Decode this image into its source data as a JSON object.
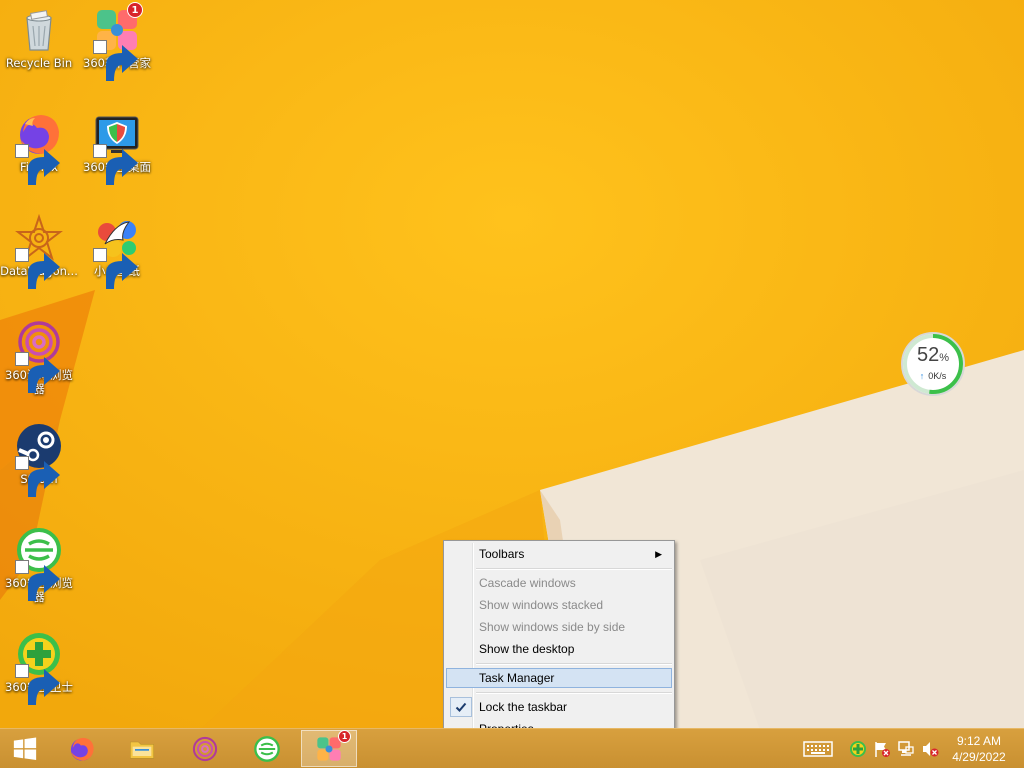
{
  "desktop": {
    "icons": [
      {
        "label": "Recycle Bin",
        "icon": "recycle-bin-icon",
        "shortcut": false
      },
      {
        "label": "360软件管家",
        "icon": "360-software-manager-icon",
        "shortcut": true,
        "badge": "1"
      },
      {
        "label": "Firefox",
        "icon": "firefox-icon",
        "shortcut": true
      },
      {
        "label": "360安全桌面",
        "icon": "360-safe-desktop-icon",
        "shortcut": true
      },
      {
        "label": "DataWagon...",
        "icon": "datawagon-icon",
        "shortcut": true
      },
      {
        "label": "小鸟壁纸",
        "icon": "bird-wallpaper-icon",
        "shortcut": true
      },
      {
        "label": "360游戏浏览器",
        "icon": "360-game-browser-icon",
        "shortcut": true
      },
      {
        "label": "Steam",
        "icon": "steam-icon",
        "shortcut": true
      },
      {
        "label": "360安全浏览器",
        "icon": "360-safe-browser-icon",
        "shortcut": true
      },
      {
        "label": "360安全卫士",
        "icon": "360-security-guard-icon",
        "shortcut": true
      }
    ]
  },
  "speed_widget": {
    "percent": "52",
    "percent_unit": "%",
    "rate": "0K/s",
    "ring_fraction": 0.52,
    "color": "#3cc04a"
  },
  "context_menu": {
    "items": [
      {
        "label": "Toolbars",
        "state": "enabled",
        "submenu": true
      },
      {
        "label": "Cascade windows",
        "state": "disabled"
      },
      {
        "label": "Show windows stacked",
        "state": "disabled"
      },
      {
        "label": "Show windows side by side",
        "state": "disabled"
      },
      {
        "label": "Show the desktop",
        "state": "enabled"
      },
      {
        "label": "Task Manager",
        "state": "highlighted"
      },
      {
        "label": "Lock the taskbar",
        "state": "checked"
      },
      {
        "label": "Properties",
        "state": "enabled"
      }
    ]
  },
  "taskbar": {
    "start_icon": "windows-start-icon",
    "pinned": [
      {
        "name": "firefox",
        "icon": "firefox-icon"
      },
      {
        "name": "file-explorer",
        "icon": "folder-icon"
      },
      {
        "name": "360-game-browser",
        "icon": "360-game-browser-icon"
      },
      {
        "name": "360-safe-browser",
        "icon": "360-safe-browser-icon"
      },
      {
        "name": "360-software-manager",
        "icon": "360-software-manager-icon",
        "active": true,
        "badge": "1"
      }
    ],
    "tray": [
      "keyboard-icon",
      "360-guard-tray-icon",
      "action-center-flag-icon",
      "network-icon",
      "volume-muted-icon"
    ],
    "clock": {
      "time": "9:12 AM",
      "date": "4/29/2022"
    }
  },
  "colors": {
    "wallpaper": "#f7b512",
    "taskbar": "#c99031",
    "menu_highlight": "#d4e3f3"
  }
}
